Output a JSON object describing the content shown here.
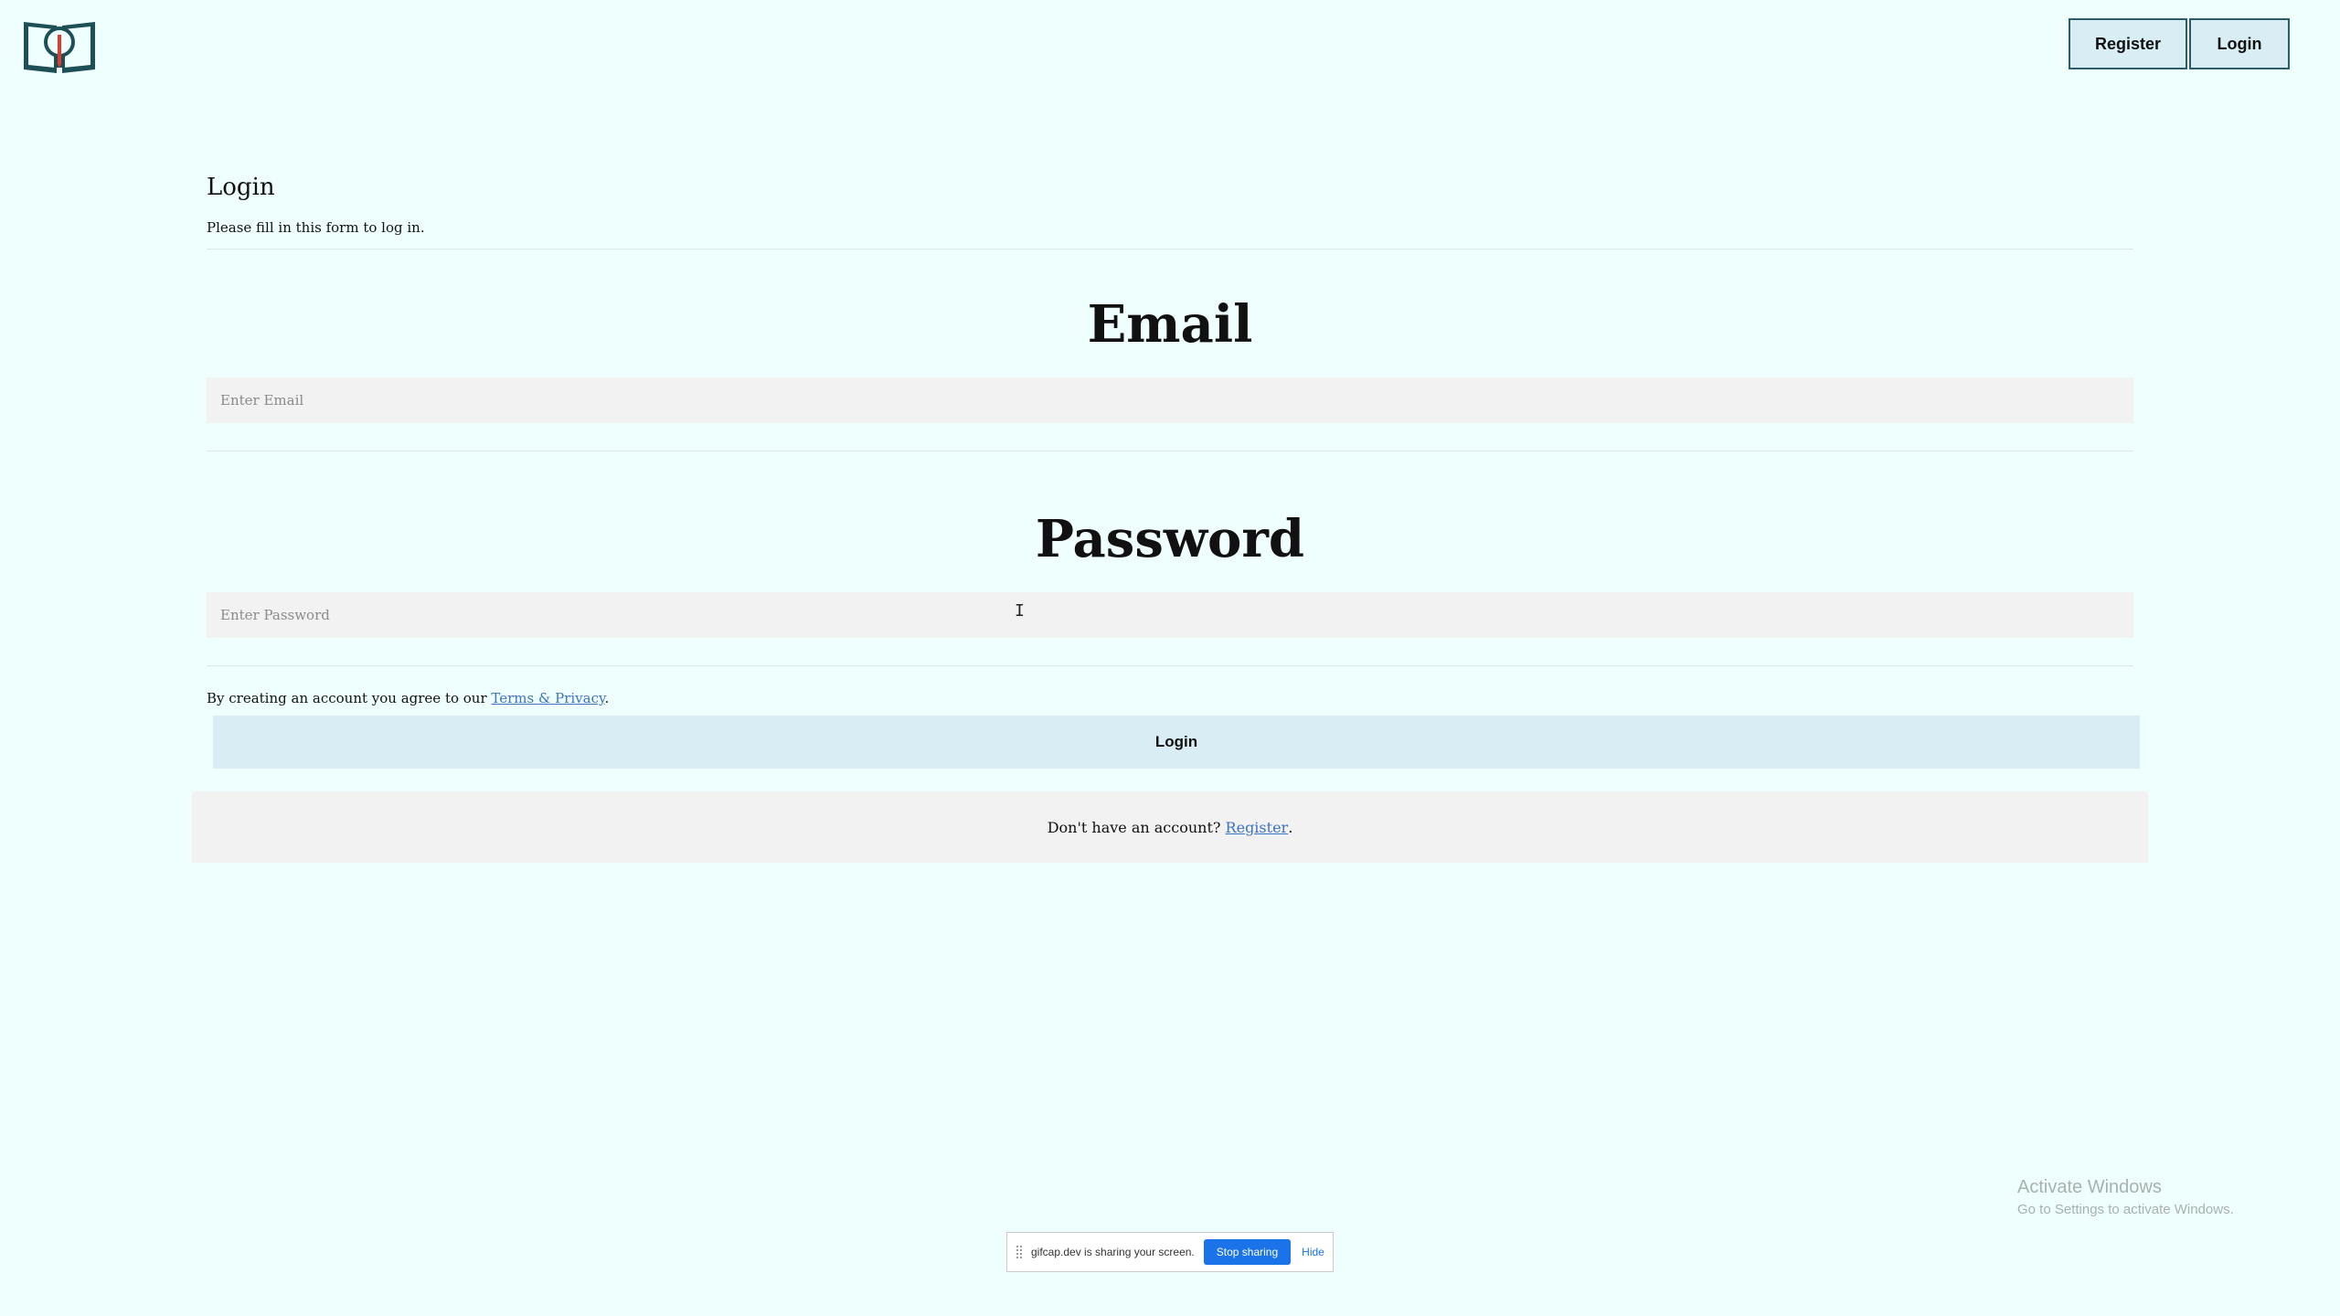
{
  "header": {
    "logo_icon": "book-lightbulb-logo-icon",
    "nav": {
      "register_label": "Register",
      "login_label": "Login"
    }
  },
  "form": {
    "title": "Login",
    "subtitle": "Please fill in this form to log in.",
    "email": {
      "label": "Email",
      "placeholder": "Enter Email",
      "value": ""
    },
    "password": {
      "label": "Password",
      "placeholder": "Enter Password",
      "value": ""
    },
    "terms_prefix": "By creating an account you agree to our ",
    "terms_link": "Terms & Privacy",
    "terms_suffix": ".",
    "submit_label": "Login"
  },
  "signin": {
    "prefix": "Don't have an account? ",
    "link": "Register",
    "suffix": "."
  },
  "screen_share": {
    "message": "gifcap.dev is sharing your screen.",
    "stop_label": "Stop sharing",
    "hide_label": "Hide"
  },
  "watermark": {
    "title": "Activate Windows",
    "subtitle": "Go to Settings to activate Windows."
  },
  "colors": {
    "page_background": "#effffd",
    "button_background": "#d8eef4",
    "input_background": "#f2f2f2",
    "link": "#3b72c4",
    "logo_teal": "#1d4f57",
    "logo_red": "#e03b2e"
  }
}
